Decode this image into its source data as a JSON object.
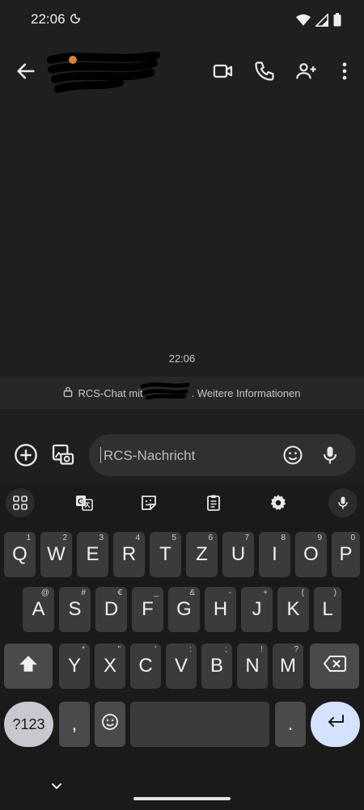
{
  "status": {
    "time": "22:06"
  },
  "header": {
    "contact_name": ""
  },
  "chat": {
    "timestamp": "22:06",
    "banner_text": "RCS-Chat mit",
    "banner_link": ". Weitere Informationen"
  },
  "compose": {
    "placeholder": "RCS-Nachricht"
  },
  "keyboard": {
    "row1": [
      {
        "k": "Q",
        "h": "1"
      },
      {
        "k": "W",
        "h": "2"
      },
      {
        "k": "E",
        "h": "3"
      },
      {
        "k": "R",
        "h": "4"
      },
      {
        "k": "T",
        "h": "5"
      },
      {
        "k": "Z",
        "h": "6"
      },
      {
        "k": "U",
        "h": "7"
      },
      {
        "k": "I",
        "h": "8"
      },
      {
        "k": "O",
        "h": "9"
      },
      {
        "k": "P",
        "h": "0"
      }
    ],
    "row2": [
      {
        "k": "A",
        "h": "@"
      },
      {
        "k": "S",
        "h": "#"
      },
      {
        "k": "D",
        "h": "€"
      },
      {
        "k": "F",
        "h": "_"
      },
      {
        "k": "G",
        "h": "&"
      },
      {
        "k": "H",
        "h": "-"
      },
      {
        "k": "J",
        "h": "+"
      },
      {
        "k": "K",
        "h": "("
      },
      {
        "k": "L",
        "h": ")"
      }
    ],
    "row3": [
      {
        "k": "Y",
        "h": "*"
      },
      {
        "k": "X",
        "h": "\""
      },
      {
        "k": "C",
        "h": "'"
      },
      {
        "k": "V",
        "h": ":"
      },
      {
        "k": "B",
        "h": ";"
      },
      {
        "k": "N",
        "h": "!"
      },
      {
        "k": "M",
        "h": "?"
      }
    ],
    "symbols_label": "?123",
    "comma": ",",
    "period": "."
  }
}
